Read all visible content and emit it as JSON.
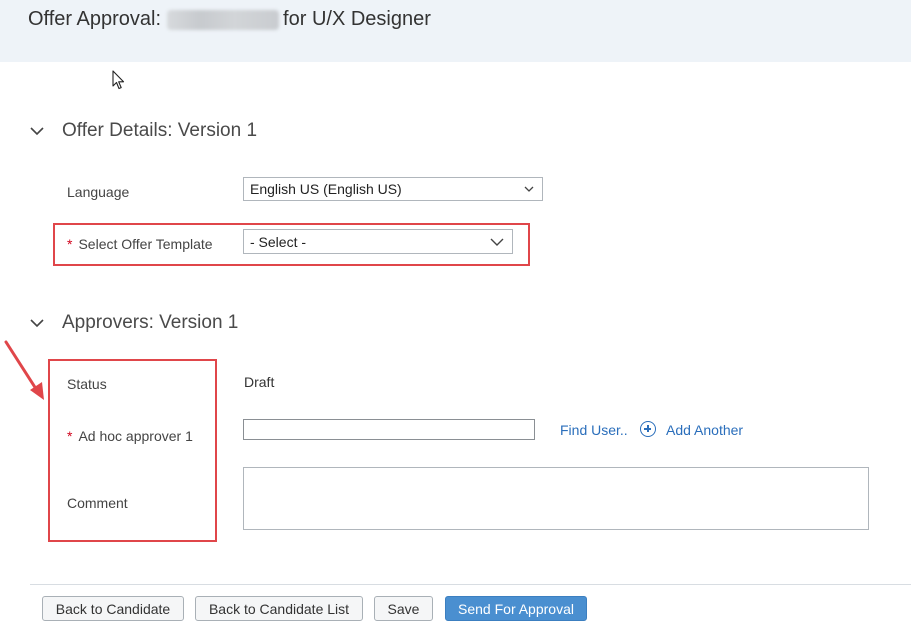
{
  "header": {
    "title_prefix": "Offer Approval:",
    "title_suffix": "for U/X Designer"
  },
  "offer_details": {
    "heading": "Offer Details: Version 1",
    "language_label": "Language",
    "language_value": "English US (English US)",
    "template_required_marker": "*",
    "template_label": "Select Offer Template",
    "template_value": "- Select -"
  },
  "approvers": {
    "heading": "Approvers: Version 1",
    "status_label": "Status",
    "status_value": "Draft",
    "approver_required_marker": "*",
    "approver_label": "Ad hoc approver 1",
    "approver_value": "",
    "find_user_link": "Find User..",
    "add_another_link": "Add Another",
    "comment_label": "Comment",
    "comment_value": ""
  },
  "footer": {
    "back_to_candidate": "Back to Candidate",
    "back_to_candidate_list": "Back to Candidate List",
    "save": "Save",
    "send_for_approval": "Send For Approval"
  },
  "colors": {
    "header_bg": "#eef3f8",
    "link": "#2a6ebb",
    "primary_button": "#4a8fd0",
    "highlight_red": "#e0464a",
    "required_red": "#d0021b"
  },
  "icons": [
    "cursor-icon",
    "chevron-down-icon",
    "caret-down-icon",
    "plus-circle-icon",
    "red-arrow-annotation"
  ]
}
